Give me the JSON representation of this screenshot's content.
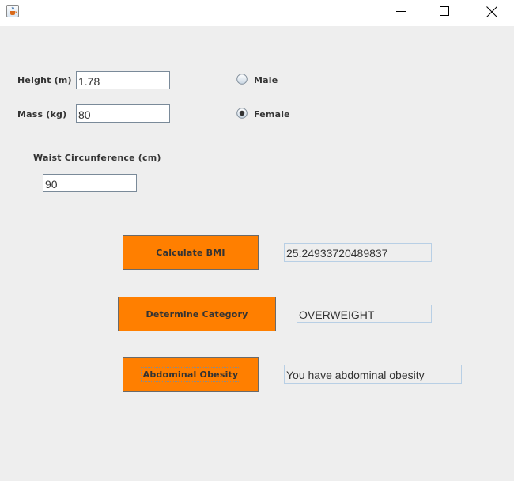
{
  "window": {
    "title": "",
    "app_icon": "java-cup-icon",
    "controls": [
      "minimize-icon",
      "maximize-icon",
      "close-icon"
    ]
  },
  "form": {
    "height": {
      "label": "Height (m)",
      "value": "1.78"
    },
    "mass": {
      "label": "Mass (kg)",
      "value": "80"
    },
    "waist": {
      "label": "Waist Circunference (cm)",
      "value": "90"
    }
  },
  "gender": {
    "male": {
      "label": "Male",
      "selected": false
    },
    "female": {
      "label": "Female",
      "selected": true
    }
  },
  "actions": {
    "calculate_bmi": {
      "label": "Calculate BMI",
      "result": "25.24933720489837"
    },
    "determine_category": {
      "label": "Determine Category",
      "result": "OVERWEIGHT"
    },
    "abdominal_obesity": {
      "label": "Abdominal Obesity",
      "result": "You have abdominal obesity"
    }
  },
  "colors": {
    "button": "#ff7f00",
    "background": "#eeeeee"
  }
}
